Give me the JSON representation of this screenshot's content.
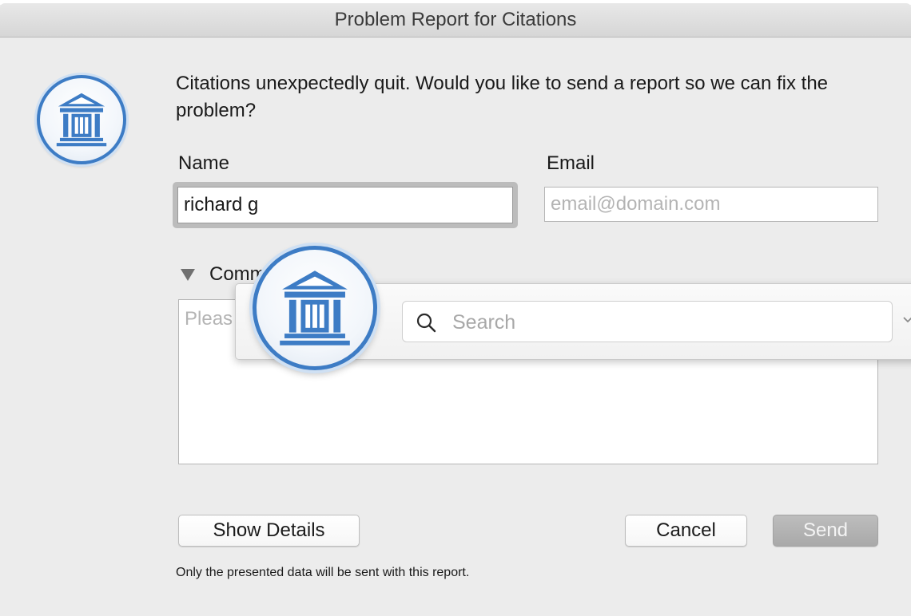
{
  "window": {
    "title": "Problem Report for Citations"
  },
  "dialog": {
    "message": "Citations unexpectedly quit. Would you like to send a report so we can fix the problem?",
    "name_label": "Name",
    "name_value": "richard g",
    "email_label": "Email",
    "email_placeholder": "email@domain.com",
    "comments_label": "Comm",
    "comments_placeholder": "Pleas",
    "buttons": {
      "show_details": "Show Details",
      "cancel": "Cancel",
      "send": "Send"
    },
    "footnote": "Only the presented data will be sent with this report."
  },
  "search_popup": {
    "search_placeholder": "Search"
  },
  "icons": {
    "app": "citations-app-icon",
    "search": "search-icon",
    "disclosure": "disclosure-triangle-icon",
    "chevron": "chevron-down-icon"
  },
  "colors": {
    "accent_blue": "#3d7cc5",
    "send_disabled": "#a9a9a9",
    "window_bg": "#ececec"
  }
}
